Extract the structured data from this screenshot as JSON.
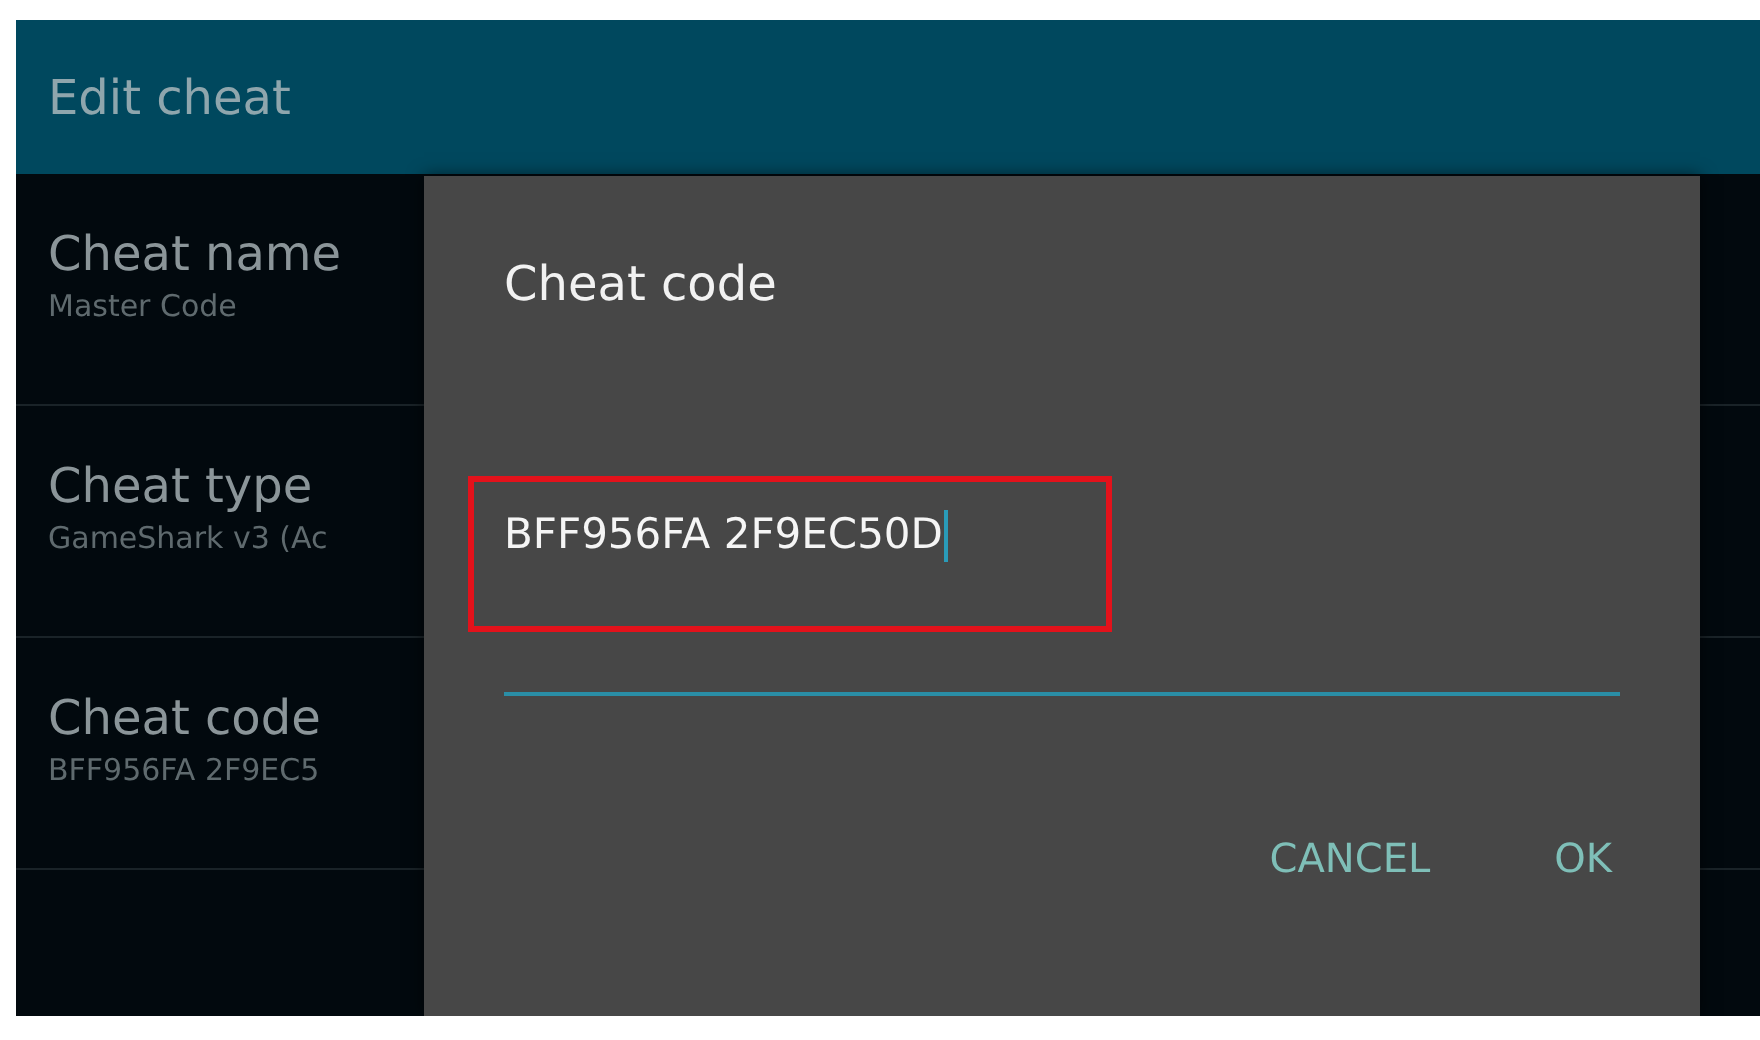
{
  "app_bar": {
    "title": "Edit cheat"
  },
  "settings": [
    {
      "title": "Cheat name",
      "summary": "Master Code"
    },
    {
      "title": "Cheat type",
      "summary": "GameShark v3 (Ac"
    },
    {
      "title": "Cheat code",
      "summary": "BFF956FA 2F9EC5"
    }
  ],
  "dialog": {
    "title": "Cheat code",
    "input": {
      "value": "BFF956FA 2F9EC50D",
      "focused": true,
      "highlighted": true
    },
    "buttons": [
      {
        "label": "CANCEL"
      },
      {
        "label": "OK"
      }
    ]
  }
}
